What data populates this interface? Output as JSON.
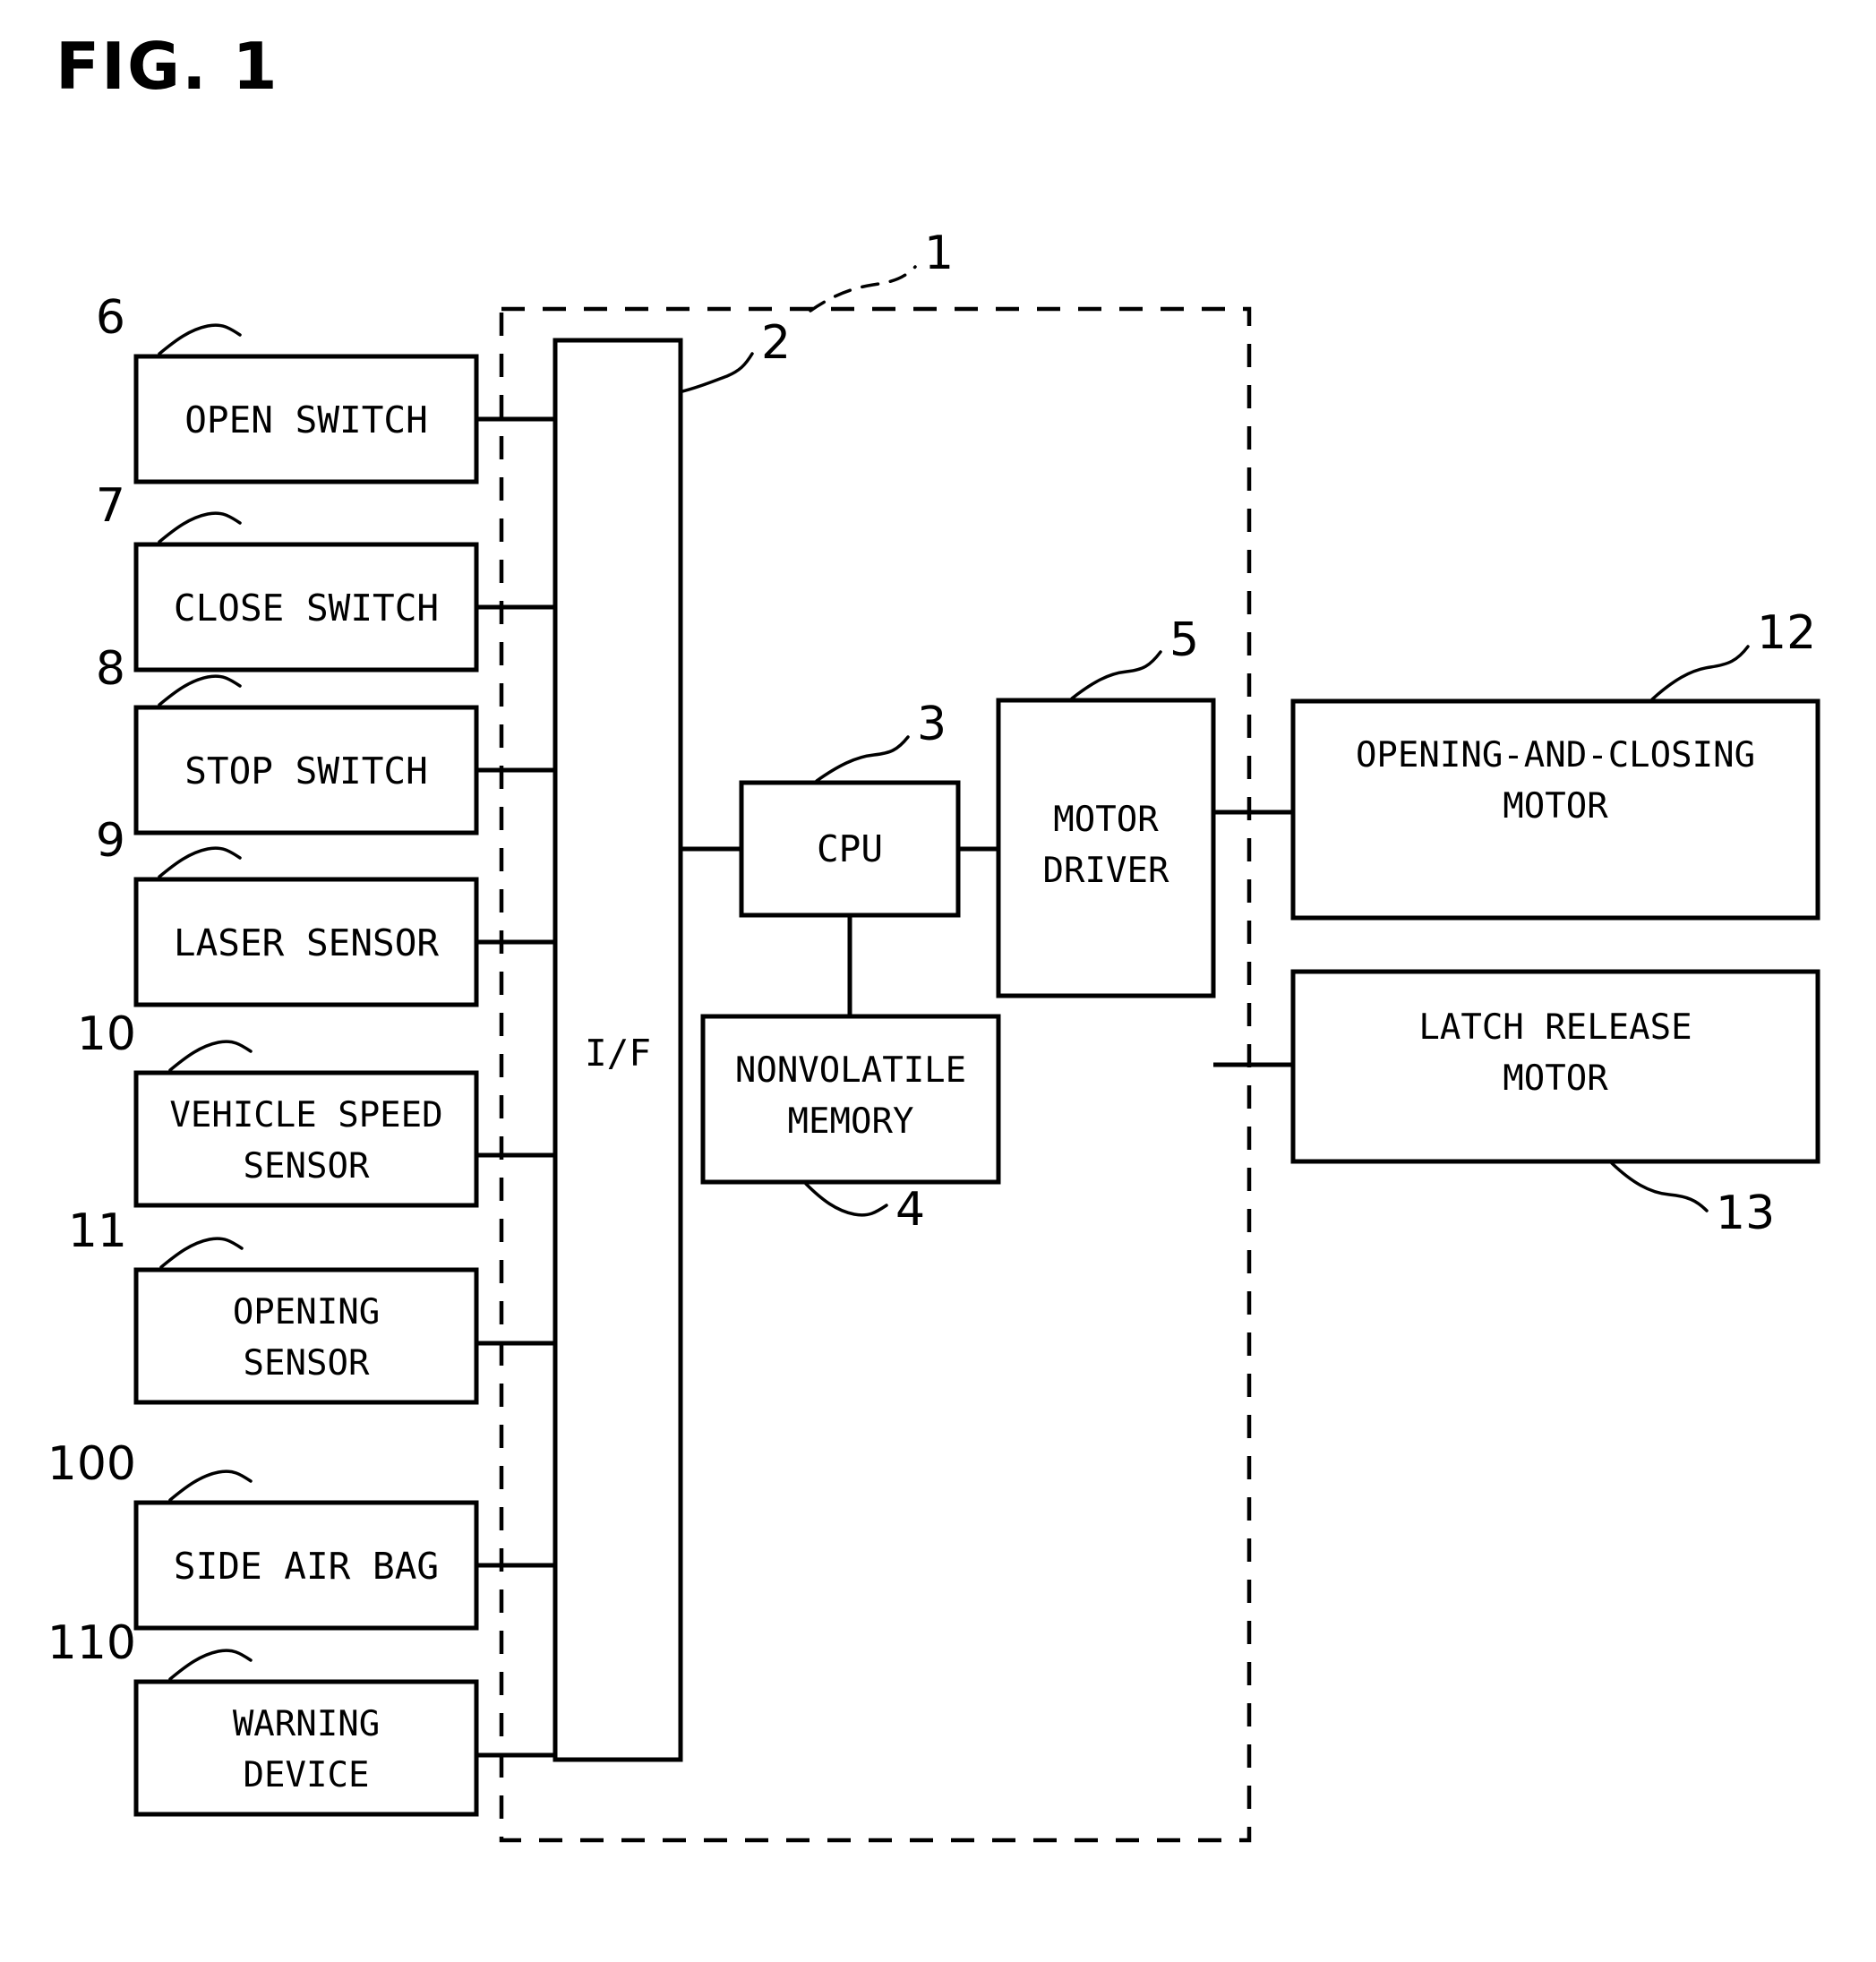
{
  "figure": {
    "title": "FIG. 1",
    "type": "patent-block-diagram",
    "description": "Vehicle opening-and-closing body control apparatus block diagram"
  },
  "controller": {
    "ref": "1",
    "boundary_style": "dashed"
  },
  "interface": {
    "label": "I/F",
    "ref": "2"
  },
  "cpu": {
    "label": "CPU",
    "ref": "3"
  },
  "memory": {
    "line1": "NONVOLATILE",
    "line2": "MEMORY",
    "ref": "4"
  },
  "motor_driver": {
    "line1": "MOTOR",
    "line2": "DRIVER",
    "ref": "5"
  },
  "inputs": [
    {
      "ref": "6",
      "line1": "OPEN SWITCH",
      "line2": ""
    },
    {
      "ref": "7",
      "line1": "CLOSE SWITCH",
      "line2": ""
    },
    {
      "ref": "8",
      "line1": "STOP SWITCH",
      "line2": ""
    },
    {
      "ref": "9",
      "line1": "LASER SENSOR",
      "line2": ""
    },
    {
      "ref": "10",
      "line1": "VEHICLE SPEED",
      "line2": "SENSOR"
    },
    {
      "ref": "11",
      "line1": "OPENING",
      "line2": "SENSOR"
    },
    {
      "ref": "100",
      "line1": "SIDE AIR BAG",
      "line2": ""
    },
    {
      "ref": "110",
      "line1": "WARNING",
      "line2": "DEVICE"
    }
  ],
  "outputs": [
    {
      "ref": "12",
      "line1": "OPENING-AND-CLOSING",
      "line2": "MOTOR"
    },
    {
      "ref": "13",
      "line1": "LATCH RELEASE",
      "line2": "MOTOR"
    }
  ],
  "colors": {
    "ink": "#000000",
    "paper": "#ffffff"
  }
}
